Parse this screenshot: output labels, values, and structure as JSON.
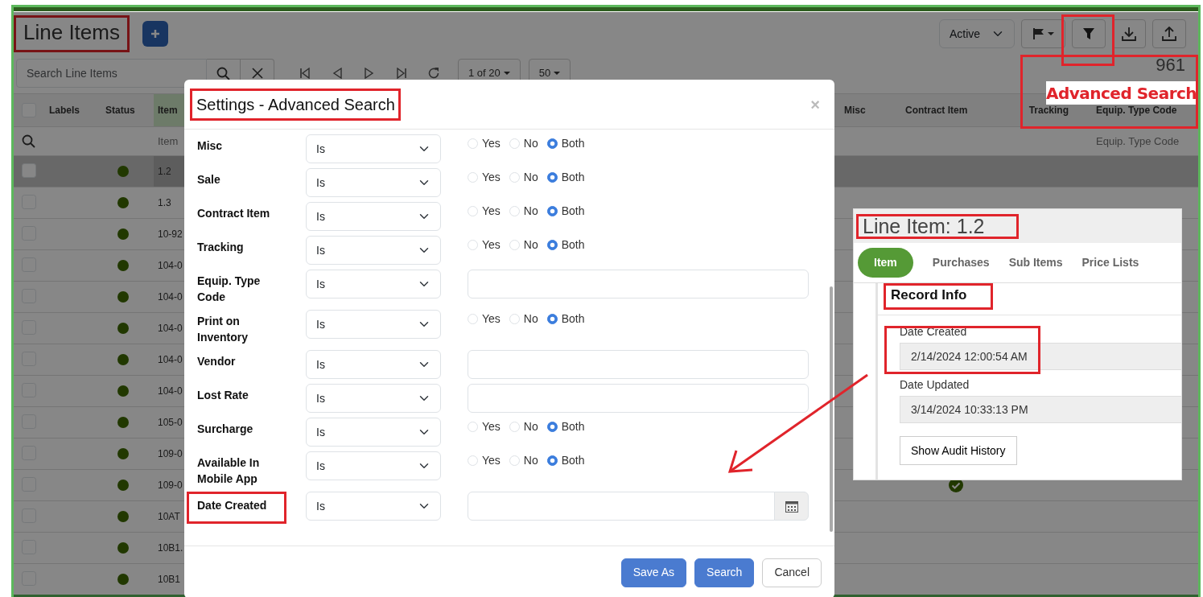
{
  "page": {
    "title": "Line Items",
    "status_filter": "Active"
  },
  "toolbar": {
    "search_placeholder": "Search Line Items",
    "pager": "1 of 20",
    "page_size": "50",
    "total": "961"
  },
  "table": {
    "columns_left": [
      "Labels",
      "Status",
      "Item"
    ],
    "columns_right": [
      "Misc",
      "Contract Item",
      "Tracking",
      "Equip. Type Code"
    ],
    "select_all_checked": false,
    "filters": {
      "item_placeholder": "Item",
      "equip_placeholder": "Equip. Type Code"
    },
    "rows": [
      {
        "item": "1.2",
        "selected": true,
        "checked": false,
        "contract_item": false
      },
      {
        "item": "1.3",
        "selected": false,
        "checked": false,
        "contract_item": false
      },
      {
        "item": "10-92",
        "selected": false,
        "checked": false,
        "contract_item": false
      },
      {
        "item": "104-0",
        "selected": false,
        "checked": false,
        "contract_item": false
      },
      {
        "item": "104-0",
        "selected": false,
        "checked": false,
        "contract_item": false
      },
      {
        "item": "104-0",
        "selected": false,
        "checked": false,
        "contract_item": false
      },
      {
        "item": "104-0",
        "selected": false,
        "checked": false,
        "contract_item": false
      },
      {
        "item": "104-0",
        "selected": false,
        "checked": false,
        "contract_item": false
      },
      {
        "item": "105-0",
        "selected": false,
        "checked": false,
        "contract_item": false
      },
      {
        "item": "109-0",
        "selected": false,
        "checked": false,
        "contract_item": false
      },
      {
        "item": "109-0",
        "selected": false,
        "checked": false,
        "contract_item": true
      },
      {
        "item": "10AT",
        "selected": false,
        "checked": false,
        "contract_item": false
      },
      {
        "item": "10B1.",
        "selected": false,
        "checked": false,
        "contract_item": false
      },
      {
        "item": "10B1",
        "selected": false,
        "checked": false,
        "contract_item": false
      }
    ]
  },
  "modal": {
    "title": "Settings - Advanced Search",
    "close": "×",
    "fields": [
      {
        "label": "Misc",
        "operator": "Is",
        "kind": "radio",
        "options": [
          {
            "label": "Yes",
            "selected": false
          },
          {
            "label": "No",
            "selected": false
          },
          {
            "label": "Both",
            "selected": true
          }
        ]
      },
      {
        "label": "Sale",
        "operator": "Is",
        "kind": "radio",
        "options": [
          {
            "label": "Yes",
            "selected": false
          },
          {
            "label": "No",
            "selected": false
          },
          {
            "label": "Both",
            "selected": true
          }
        ]
      },
      {
        "label": "Contract Item",
        "operator": "Is",
        "kind": "radio",
        "options": [
          {
            "label": "Yes",
            "selected": false
          },
          {
            "label": "No",
            "selected": false
          },
          {
            "label": "Both",
            "selected": true
          }
        ]
      },
      {
        "label": "Tracking",
        "operator": "Is",
        "kind": "radio",
        "options": [
          {
            "label": "Yes",
            "selected": false
          },
          {
            "label": "No",
            "selected": false
          },
          {
            "label": "Both",
            "selected": true
          }
        ]
      },
      {
        "label": "Equip. Type Code",
        "operator": "Is",
        "kind": "text"
      },
      {
        "label": "Print on Inventory",
        "operator": "Is",
        "kind": "radio",
        "options": [
          {
            "label": "Yes",
            "selected": false
          },
          {
            "label": "No",
            "selected": false
          },
          {
            "label": "Both",
            "selected": true
          }
        ]
      },
      {
        "label": "Vendor",
        "operator": "Is",
        "kind": "text"
      },
      {
        "label": "Lost Rate",
        "operator": "Is",
        "kind": "text"
      },
      {
        "label": "Surcharge",
        "operator": "Is",
        "kind": "radio",
        "options": [
          {
            "label": "Yes",
            "selected": false
          },
          {
            "label": "No",
            "selected": false
          },
          {
            "label": "Both",
            "selected": true
          }
        ]
      },
      {
        "label": "Available In Mobile App",
        "operator": "Is",
        "kind": "radio",
        "options": [
          {
            "label": "Yes",
            "selected": false
          },
          {
            "label": "No",
            "selected": false
          },
          {
            "label": "Both",
            "selected": true
          }
        ]
      },
      {
        "label": "Date Created",
        "operator": "Is",
        "kind": "date"
      }
    ],
    "buttons": [
      {
        "label": "Save As",
        "kind": "primary"
      },
      {
        "label": "Search",
        "kind": "primary"
      },
      {
        "label": "Cancel",
        "kind": "secondary"
      }
    ]
  },
  "detail_panel": {
    "title": "Line Item: 1.2",
    "tabs": [
      {
        "label": "Item",
        "selected": true
      },
      {
        "label": "Purchases",
        "selected": false
      },
      {
        "label": "Sub Items",
        "selected": false
      },
      {
        "label": "Price Lists",
        "selected": false
      }
    ],
    "section": "Record Info",
    "fields": [
      {
        "label": "Date Created",
        "value": "2/14/2024 12:00:54 AM"
      },
      {
        "label": "Date Updated",
        "value": "3/14/2024 10:33:13 PM"
      }
    ],
    "button": "Show Audit History"
  },
  "annotation": {
    "callout": "Advanced Search"
  }
}
